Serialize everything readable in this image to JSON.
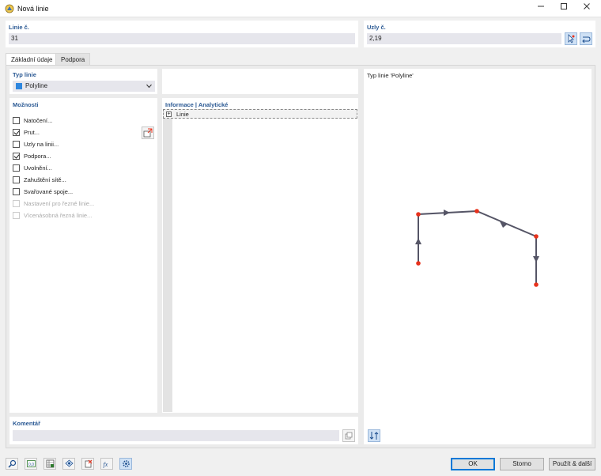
{
  "window": {
    "title": "Nová linie"
  },
  "line_no": {
    "label": "Linie č.",
    "value": "31"
  },
  "nodes_no": {
    "label": "Uzly č.",
    "value": "2,19"
  },
  "tabs": [
    {
      "label": "Základní údaje"
    },
    {
      "label": "Podpora"
    }
  ],
  "line_type": {
    "label": "Typ linie",
    "value": "Polyline",
    "swatch_color": "#2e86de"
  },
  "options": {
    "label": "Možnosti",
    "items": [
      {
        "label": "Natočení...",
        "checked": false,
        "enabled": true
      },
      {
        "label": "Prut...",
        "checked": true,
        "enabled": true
      },
      {
        "label": "Uzly na linii...",
        "checked": false,
        "enabled": true
      },
      {
        "label": "Podpora...",
        "checked": true,
        "enabled": true
      },
      {
        "label": "Uvolnění...",
        "checked": false,
        "enabled": true
      },
      {
        "label": "Zahuštění sítě...",
        "checked": false,
        "enabled": true
      },
      {
        "label": "Svařované spoje...",
        "checked": false,
        "enabled": true
      },
      {
        "label": "Nastavení pro řezné linie...",
        "checked": false,
        "enabled": false
      },
      {
        "label": "Vícenásobná řezná linie...",
        "checked": false,
        "enabled": false
      }
    ]
  },
  "info": {
    "label": "Informace | Analytické",
    "tree_item": "Linie"
  },
  "preview": {
    "label": "Typ linie 'Polyline'",
    "line_color": "#555566",
    "node_color": "#e8321c"
  },
  "comment": {
    "label": "Komentář",
    "value": ""
  },
  "buttons": {
    "ok": "OK",
    "cancel": "Storno",
    "apply_next": "Použít & další"
  }
}
